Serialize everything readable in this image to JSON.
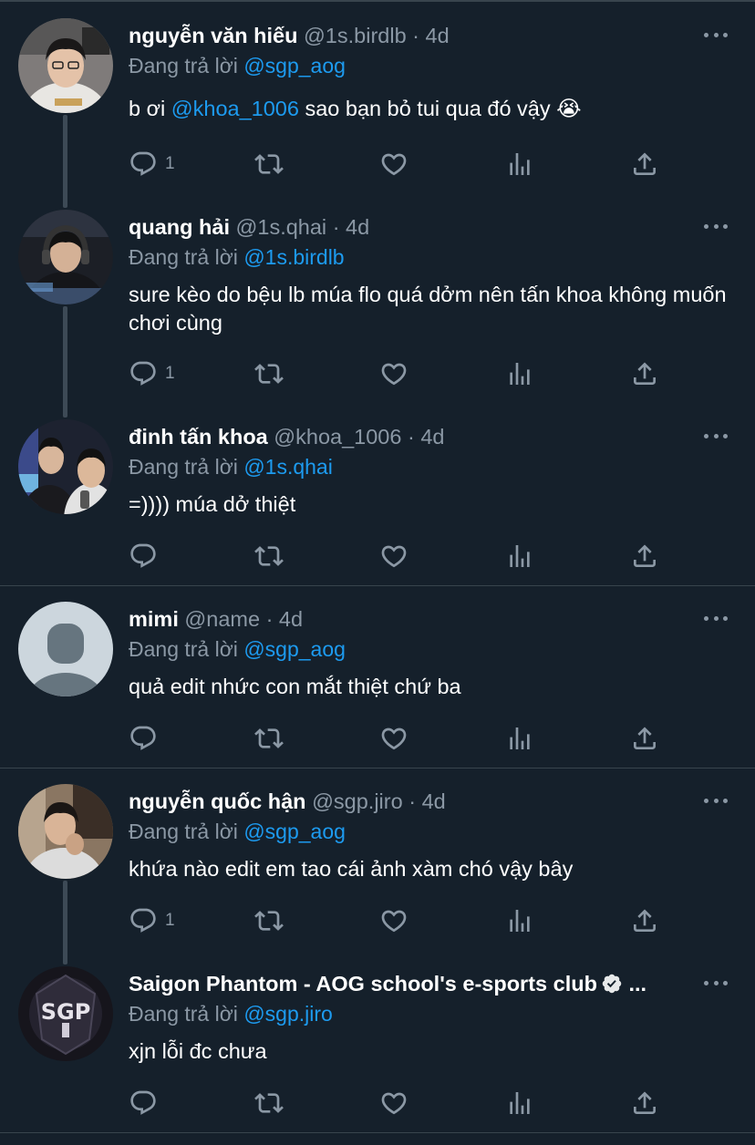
{
  "replying_label": "Đang trả lời",
  "tweets": [
    {
      "name": "nguyễn văn hiếu",
      "handle": "@1s.birdlb",
      "time": "4d",
      "reply_to": "@sgp_aog",
      "text_parts": [
        "b ơi ",
        "@khoa_1006",
        " sao bạn bỏ tui qua đó vậy ",
        "😭"
      ],
      "reply_count": "1"
    },
    {
      "name": "quang hải",
      "handle": "@1s.qhai",
      "time": "4d",
      "reply_to": "@1s.birdlb",
      "text": "sure kèo do bệu lb múa flo quá dởm nên tấn khoa không muốn chơi cùng",
      "reply_count": "1"
    },
    {
      "name": "đinh tấn khoa",
      "handle": "@khoa_1006",
      "time": "4d",
      "reply_to": "@1s.qhai",
      "text": "=)))) múa dở thiệt",
      "reply_count": ""
    },
    {
      "name": "mimi",
      "handle": "@name",
      "time": "4d",
      "reply_to": "@sgp_aog",
      "text": "quả edit nhức con mắt thiệt chứ ba",
      "reply_count": ""
    },
    {
      "name": "nguyễn quốc hận",
      "handle": "@sgp.jiro",
      "time": "4d",
      "reply_to": "@sgp_aog",
      "text": "khứa nào edit em tao cái ảnh xàm chó vậy bây",
      "reply_count": "1"
    },
    {
      "name": "Saigon Phantom - AOG school's e-sports club",
      "name_suffix": "...",
      "verified": true,
      "reply_to": "@sgp.jiro",
      "text": "xjn lỗi đc chưa",
      "reply_count": "",
      "avatar_logo_text": "SGP"
    }
  ],
  "colors": {
    "background": "#15202b",
    "border": "#38444d",
    "secondary_text": "#8b98a5",
    "link": "#1d9bf0",
    "icon": "#8b98a5"
  },
  "icons": [
    "reply-icon",
    "retweet-icon",
    "like-icon",
    "analytics-icon",
    "share-icon",
    "more-icon",
    "verified-badge-icon"
  ]
}
